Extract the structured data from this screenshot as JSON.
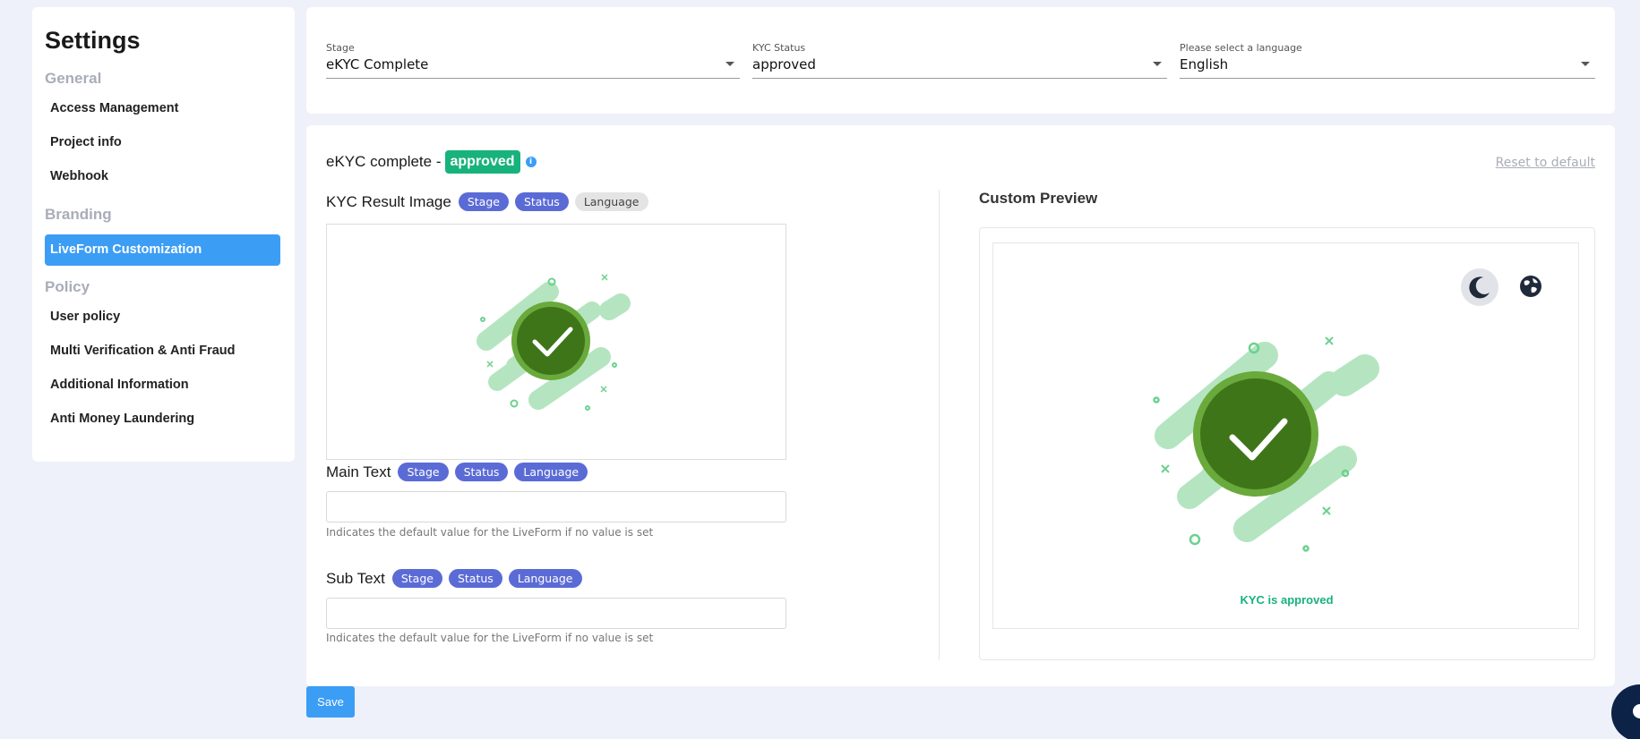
{
  "sidebar": {
    "title": "Settings",
    "sections": [
      {
        "label": "General",
        "items": [
          "Access Management",
          "Project info",
          "Webhook"
        ]
      },
      {
        "label": "Branding",
        "items": [
          "LiveForm Customization"
        ]
      },
      {
        "label": "Policy",
        "items": [
          "User policy",
          "Multi Verification & Anti Fraud",
          "Additional Information",
          "Anti Money Laundering"
        ]
      }
    ],
    "active_item": "LiveForm Customization"
  },
  "filters": {
    "stage": {
      "label": "Stage",
      "value": "eKYC Complete"
    },
    "kyc_status": {
      "label": "KYC Status",
      "value": "approved"
    },
    "language": {
      "label": "Please select a language",
      "value": "English"
    }
  },
  "main": {
    "header_text": "eKYC complete -",
    "header_badge": "approved",
    "info_icon": "info-icon",
    "reset_label": "Reset to default",
    "chips": {
      "stage": "Stage",
      "status": "Status",
      "language": "Language"
    },
    "result_image": {
      "title": "KYC Result Image"
    },
    "main_text": {
      "title": "Main Text",
      "value": "",
      "hint": "Indicates the default value for the LiveForm if no value is set"
    },
    "sub_text": {
      "title": "Sub Text",
      "value": "",
      "hint": "Indicates the default value for the LiveForm if no value is set"
    }
  },
  "preview": {
    "title": "Custom Preview",
    "caption": "KYC is approved",
    "icons": [
      "moon-icon",
      "globe-icon"
    ]
  },
  "save_label": "Save",
  "colors": {
    "accent": "#3c9df5",
    "chip": "#5b6bd6",
    "success": "#18b27c",
    "check_dark": "#3e7519",
    "check_ring": "#6aa93b",
    "stripe": "#b4e5c0"
  }
}
